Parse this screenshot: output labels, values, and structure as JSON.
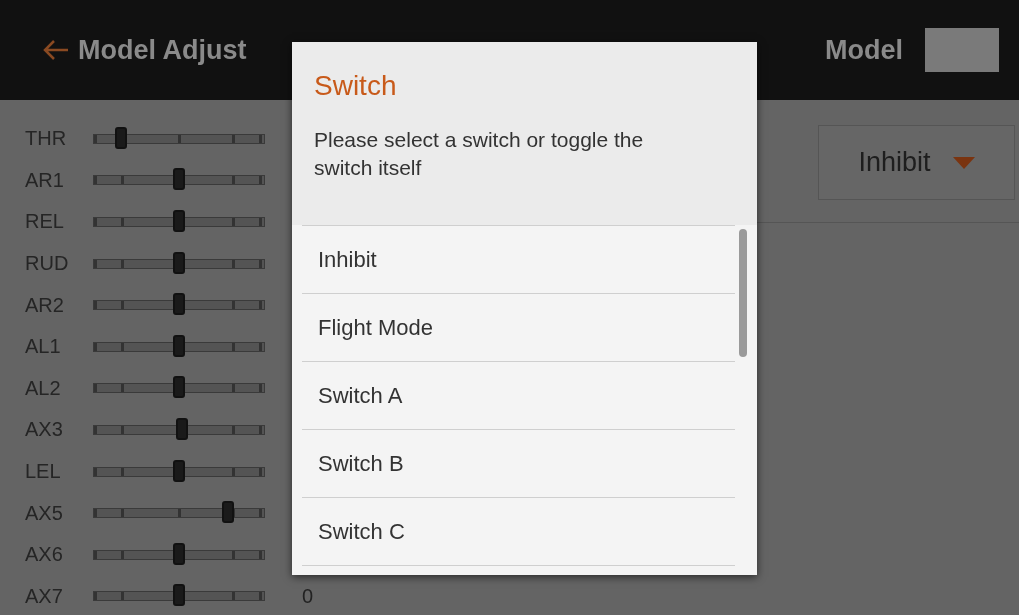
{
  "header": {
    "back_label": "Model Adjust",
    "model_label": "Model"
  },
  "channels": [
    {
      "name": "THR",
      "level": 0.16
    },
    {
      "name": "AR1",
      "level": 0.5
    },
    {
      "name": "REL",
      "level": 0.5
    },
    {
      "name": "RUD",
      "level": 0.5
    },
    {
      "name": "AR2",
      "level": 0.5
    },
    {
      "name": "AL1",
      "level": 0.5
    },
    {
      "name": "AL2",
      "level": 0.5
    },
    {
      "name": "AX3",
      "level": 0.52
    },
    {
      "name": "LEL",
      "level": 0.5
    },
    {
      "name": "AX5",
      "level": 0.79
    },
    {
      "name": "AX6",
      "level": 0.5
    },
    {
      "name": "AX7",
      "level": 0.5,
      "value": "0"
    }
  ],
  "dropdown": {
    "value": "Inhibit"
  },
  "dialog": {
    "title": "Switch",
    "message": "Please select a switch or toggle the switch itself",
    "options": [
      "Inhibit",
      "Flight Mode",
      "Switch A",
      "Switch B",
      "Switch C"
    ]
  }
}
